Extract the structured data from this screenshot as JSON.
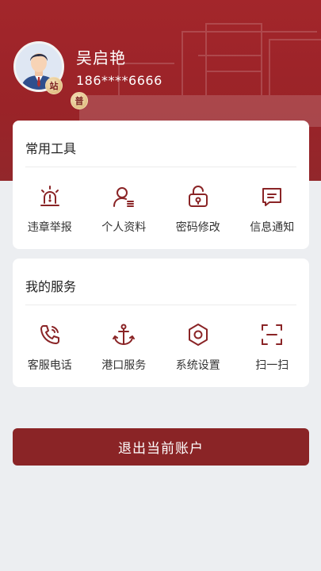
{
  "user": {
    "name": "吴启艳",
    "phone": "186****6666",
    "badge_station": "站",
    "badge_normal": "普"
  },
  "tools": {
    "title": "常用工具",
    "items": [
      {
        "label": "违章举报",
        "icon": "alarm-icon"
      },
      {
        "label": "个人资料",
        "icon": "profile-icon"
      },
      {
        "label": "密码修改",
        "icon": "lock-icon"
      },
      {
        "label": "信息通知",
        "icon": "message-icon"
      }
    ]
  },
  "services": {
    "title": "我的服务",
    "items": [
      {
        "label": "客服电话",
        "icon": "phone-icon"
      },
      {
        "label": "港口服务",
        "icon": "anchor-icon"
      },
      {
        "label": "系统设置",
        "icon": "settings-icon"
      },
      {
        "label": "扫一扫",
        "icon": "scan-icon"
      }
    ]
  },
  "logout": {
    "label": "退出当前账户"
  },
  "colors": {
    "primary": "#8a2426",
    "header": "#a3262b",
    "icon": "#8a2426",
    "background": "#eceef1"
  }
}
